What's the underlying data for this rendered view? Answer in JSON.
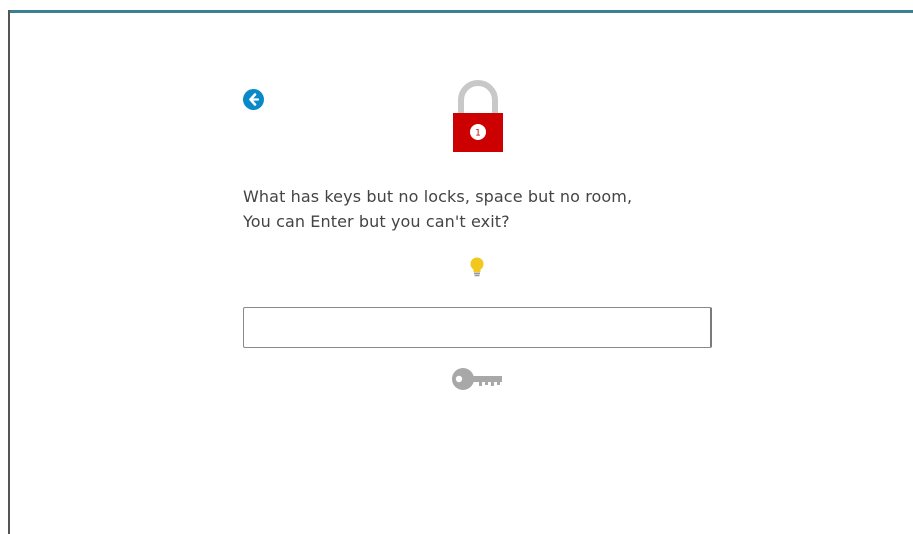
{
  "puzzle": {
    "riddle_line_1": "What has keys but no locks, space but no room,",
    "riddle_line_2": "You can Enter but you can't exit?",
    "lock_number": "1",
    "answer_value": "",
    "answer_placeholder": ""
  },
  "icons": {
    "back": "back-arrow-circle-icon",
    "lock": "padlock-icon",
    "hint": "lightbulb-icon",
    "submit": "key-icon"
  },
  "colors": {
    "accent_blue": "#0a89c9",
    "lock_red": "#cc0000",
    "lock_shackle": "#c8c8c8",
    "hint_yellow": "#f2c81c",
    "key_gray": "#a8a8a8",
    "text": "#444444",
    "top_border": "#3d7f92"
  }
}
